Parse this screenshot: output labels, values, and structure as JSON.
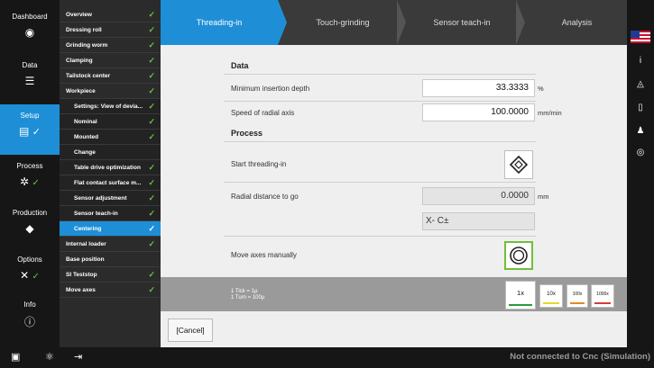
{
  "nav": {
    "dashboard": "Dashboard",
    "data": "Data",
    "setup": "Setup",
    "process": "Process",
    "production": "Production",
    "options": "Options",
    "info": "Info"
  },
  "tree": [
    {
      "label": "Overview",
      "check": "✓"
    },
    {
      "label": "Dressing roll",
      "check": "✓"
    },
    {
      "label": "Grinding worm",
      "check": "✓"
    },
    {
      "label": "Clamping",
      "check": "✓"
    },
    {
      "label": "Tailstock center",
      "check": "✓"
    },
    {
      "label": "Workpiece",
      "check": "✓"
    },
    {
      "label": "Settings: View of devia...",
      "check": "✓"
    },
    {
      "label": "Nominal",
      "check": "✓"
    },
    {
      "label": "Mounted",
      "check": "✓"
    },
    {
      "label": "Change",
      "check": ""
    },
    {
      "label": "Table drive optimization",
      "check": "✓"
    },
    {
      "label": "Flat contact surface m...",
      "check": "✓"
    },
    {
      "label": "Sensor adjustment",
      "check": "✓"
    },
    {
      "label": "Sensor teach-in",
      "check": "✓"
    },
    {
      "label": "Centering",
      "check": "✓"
    },
    {
      "label": "Internal loader",
      "check": "✓"
    },
    {
      "label": "Base position",
      "check": ""
    },
    {
      "label": "SI Teststop",
      "check": "✓"
    },
    {
      "label": "Move axes",
      "check": "✓"
    }
  ],
  "tabs": [
    "Threading-in",
    "Touch-grinding",
    "Sensor teach-in",
    "Analysis"
  ],
  "content": {
    "data_header": "Data",
    "min_depth_label": "Minimum insertion depth",
    "min_depth_value": "33.3333",
    "min_depth_unit": "%",
    "speed_label": "Speed of radial axis",
    "speed_value": "100.0000",
    "speed_unit": "mm/min",
    "process_header": "Process",
    "start_label": "Start threading-in",
    "radial_label": "Radial distance to go",
    "radial_value": "0.0000",
    "radial_unit": "mm",
    "axis_value": "X- C±",
    "move_label": "Move axes manually"
  },
  "jog": {
    "tick": "1 Tick = 1µ",
    "turn": "1 Turn = 100µ",
    "buttons": [
      "1x",
      "10x",
      "100x",
      "1000x"
    ],
    "colors": [
      "#2a9a3a",
      "#e8d82a",
      "#e08a2a",
      "#d83a3a"
    ]
  },
  "cancel": "[Cancel]",
  "status": "Not connected to Cnc (Simulation)",
  "colors": {
    "accent": "#1e8fd6",
    "check": "#6fc03a"
  },
  "icons": {
    "dashboard": "gauge-icon",
    "data": "data-list-icon",
    "setup": "setup-clipboard-icon",
    "process": "gears-icon",
    "production": "diamond-icon",
    "options": "tools-icon",
    "info": "info-icon"
  }
}
